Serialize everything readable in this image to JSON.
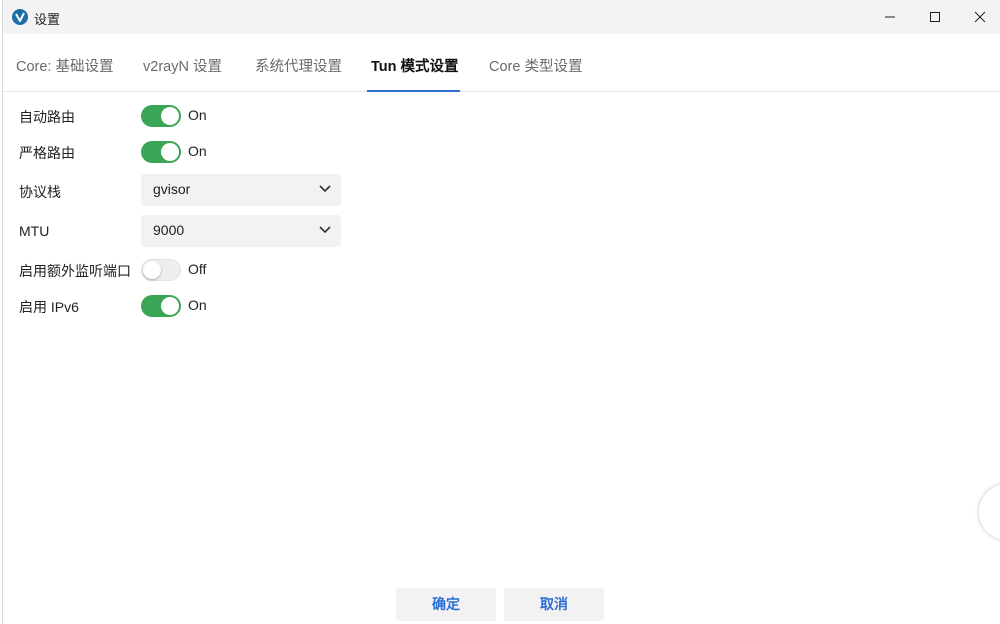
{
  "window": {
    "title": "设置"
  },
  "tabs": [
    {
      "label": "Core: 基础设置"
    },
    {
      "label": "v2rayN 设置"
    },
    {
      "label": "系统代理设置"
    },
    {
      "label": "Tun 模式设置"
    },
    {
      "label": "Core 类型设置"
    }
  ],
  "active_tab": "Tun 模式设置",
  "settings": {
    "auto_route": {
      "label": "自动路由",
      "state": "On"
    },
    "strict_route": {
      "label": "严格路由",
      "state": "On"
    },
    "stack": {
      "label": "协议栈",
      "value": "gvisor"
    },
    "mtu": {
      "label": "MTU",
      "value": "9000"
    },
    "extra_listen": {
      "label": "启用额外监听端口",
      "state": "Off"
    },
    "ipv6": {
      "label": "启用 IPv6",
      "state": "On"
    }
  },
  "buttons": {
    "ok": "确定",
    "cancel": "取消"
  },
  "colors": {
    "toggle_on": "#3aa655",
    "accent": "#2f6fce",
    "button_text": "#2a6fd6"
  }
}
